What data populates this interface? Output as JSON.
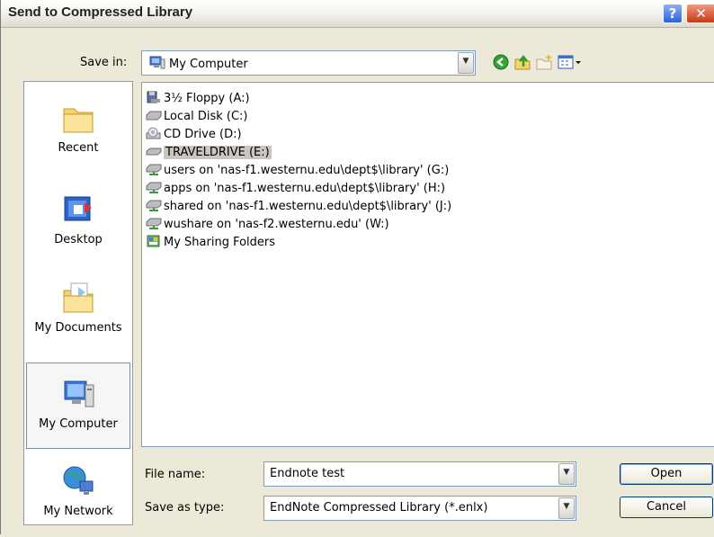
{
  "dialog": {
    "title": "Send to Compressed Library",
    "help_symbol": "?",
    "close_symbol": "✕"
  },
  "save_in": {
    "label": "Save in:",
    "value": "My Computer",
    "icon": "my-computer-icon"
  },
  "toolbar": {
    "icons": [
      "back-icon",
      "up-folder-icon",
      "new-folder-icon",
      "views-menu-icon"
    ]
  },
  "places": [
    {
      "label": "Recent",
      "icon": "recent-folder-icon"
    },
    {
      "label": "Desktop",
      "icon": "desktop-icon"
    },
    {
      "label": "My Documents",
      "icon": "my-documents-icon"
    },
    {
      "label": "My Computer",
      "icon": "my-computer-icon",
      "selected": true
    },
    {
      "label": "My Network",
      "icon": "my-network-icon"
    }
  ],
  "files": [
    {
      "label": "3½ Floppy (A:)",
      "icon": "floppy-drive-icon"
    },
    {
      "label": "Local Disk (C:)",
      "icon": "hard-disk-icon"
    },
    {
      "label": "CD Drive (D:)",
      "icon": "cd-drive-icon"
    },
    {
      "label": "TRAVELDRIVE (E:)",
      "icon": "removable-drive-icon",
      "selected": true
    },
    {
      "label": "users on 'nas-f1.westernu.edu\\dept$\\library' (G:)",
      "icon": "network-drive-icon"
    },
    {
      "label": "apps on 'nas-f1.westernu.edu\\dept$\\library' (H:)",
      "icon": "network-drive-icon"
    },
    {
      "label": "shared on 'nas-f1.westernu.edu\\dept$\\library' (J:)",
      "icon": "network-drive-icon"
    },
    {
      "label": "wushare on 'nas-f2.westernu.edu' (W:)",
      "icon": "network-drive-icon"
    },
    {
      "label": "My Sharing Folders",
      "icon": "sharing-folders-icon"
    }
  ],
  "file_name": {
    "label": "File name:",
    "value": "Endnote test"
  },
  "save_as_type": {
    "label": "Save as type:",
    "value": "EndNote Compressed Library (*.enlx)"
  },
  "buttons": {
    "open": "Open",
    "cancel": "Cancel"
  },
  "colors": {
    "dialog_bg": "#ece9d8",
    "selection_bg": "#c9c7bf",
    "input_border": "#7f9db9"
  }
}
